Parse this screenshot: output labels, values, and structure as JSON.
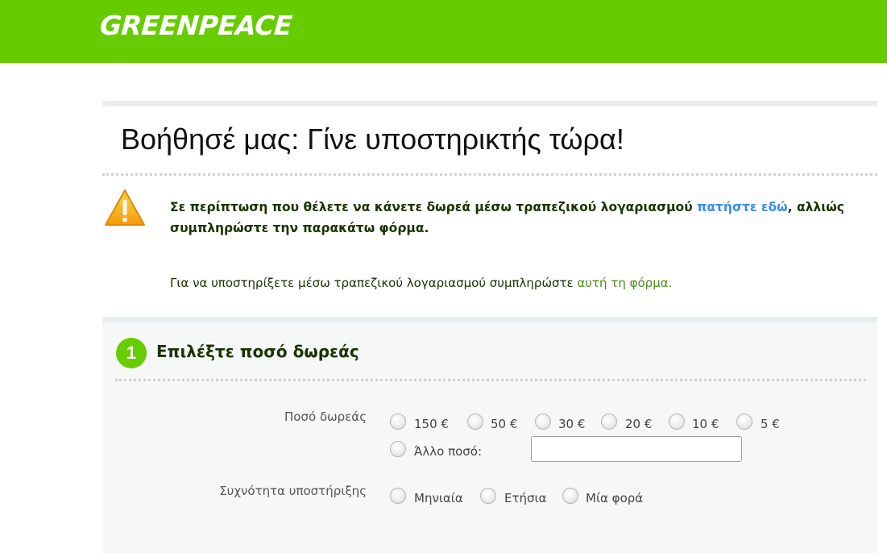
{
  "header": {
    "logo_text": "GREENPEACE",
    "brand_color": "#66cc00"
  },
  "page": {
    "title": "Βοήθησέ μας: Γίνε υποστηρικτής τώρα!"
  },
  "notice": {
    "icon": "warning-triangle-icon",
    "text_before": "Σε περίπτωση που θέλετε να κάνετε δωρεά μέσω τραπεζικού λογαριασμού ",
    "link": "πατήστε εδώ",
    "text_after": ", αλλιώς συμπληρώστε την παρακάτω φόρμα."
  },
  "info": {
    "text": "Για να υποστηρίξετε μέσω τραπεζικού λογαριασμού συμπληρώστε ",
    "link": "αυτή τη φόρμα."
  },
  "step1": {
    "number": "1",
    "title": "Επιλέξτε ποσό δωρεάς",
    "amount_label": "Ποσό δωρεάς",
    "amounts": [
      "150 €",
      "50 €",
      "30 €",
      "20 €",
      "10 €",
      "5 €"
    ],
    "other_label": "Άλλο ποσό:",
    "other_value": "",
    "frequency_label": "Συχνότητα υποστήριξης",
    "frequencies": [
      "Μηνιαία",
      "Ετήσια",
      "Μία φορά"
    ]
  }
}
